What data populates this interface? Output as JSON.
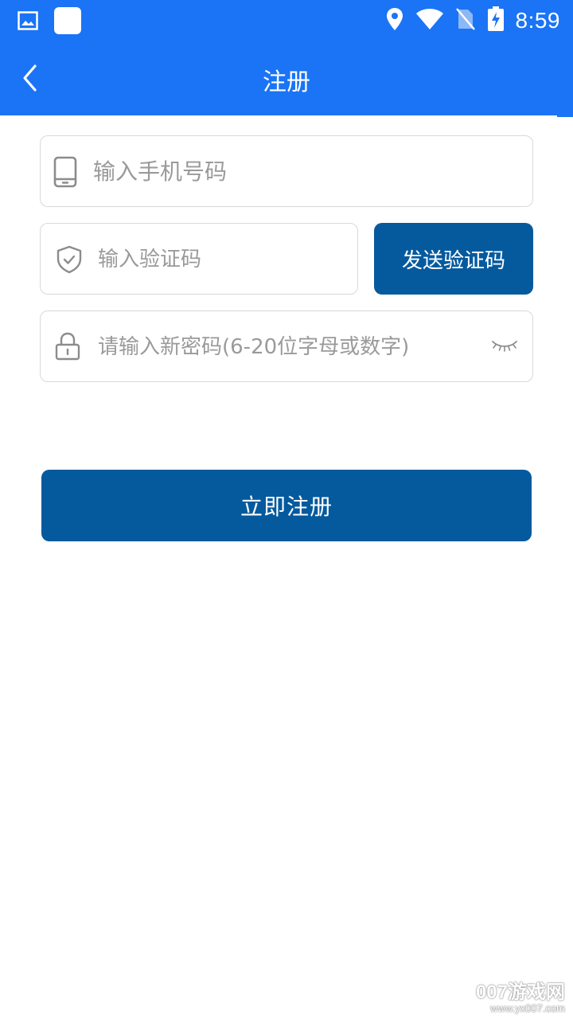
{
  "status_bar": {
    "time": "8:59",
    "icons": [
      "gallery-icon",
      "app-square-icon",
      "location-icon",
      "wifi-icon",
      "no-sim-icon",
      "battery-charging-icon"
    ]
  },
  "nav": {
    "title": "注册",
    "back_icon": "chevron-left-icon"
  },
  "form": {
    "phone": {
      "placeholder": "输入手机号码",
      "value": "",
      "icon": "phone-icon"
    },
    "code": {
      "placeholder": "输入验证码",
      "value": "",
      "icon": "shield-check-icon"
    },
    "send_code_label": "发送验证码",
    "password": {
      "placeholder": "请输入新密码(6-20位字母或数字)",
      "value": "",
      "icon": "lock-icon",
      "toggle_icon": "eye-closed-icon"
    },
    "submit_label": "立即注册"
  },
  "colors": {
    "header": "#1a74f5",
    "button": "#055a9e",
    "border": "#d9d9d9",
    "placeholder": "#9a9a9a"
  },
  "watermark": {
    "main": "007游戏网",
    "sub": "www.yx007.com"
  }
}
